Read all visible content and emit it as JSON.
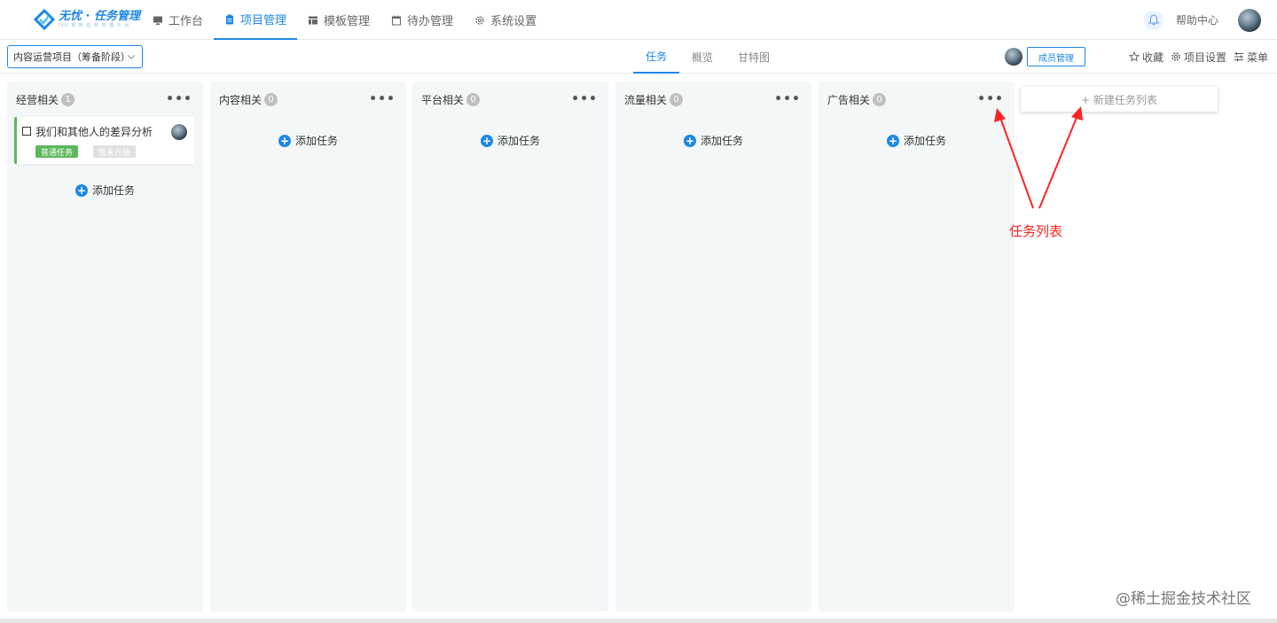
{
  "brand": {
    "title": "无忧 · 任务管理",
    "subtitle": "IVU 项 目 任 务 管 理 平 台"
  },
  "nav": {
    "items": [
      {
        "label": "工作台",
        "icon": "monitor-icon"
      },
      {
        "label": "项目管理",
        "icon": "clipboard-icon",
        "active": true
      },
      {
        "label": "模板管理",
        "icon": "template-icon"
      },
      {
        "label": "待办管理",
        "icon": "calendar-icon"
      },
      {
        "label": "系统设置",
        "icon": "gear-icon"
      }
    ],
    "help": "帮助中心"
  },
  "subbar": {
    "project": "内容运营项目（筹备阶段）",
    "tabs": [
      {
        "label": "任务",
        "active": true
      },
      {
        "label": "概览"
      },
      {
        "label": "甘特图"
      }
    ],
    "member_button": "成员管理",
    "actions": [
      {
        "label": "收藏",
        "icon": "star-icon"
      },
      {
        "label": "项目设置",
        "icon": "gear-icon"
      },
      {
        "label": "菜单",
        "icon": "menu-icon"
      }
    ]
  },
  "columns": [
    {
      "title": "经营相关",
      "count": "1",
      "add_label": "添加任务"
    },
    {
      "title": "内容相关",
      "count": "0",
      "add_label": "添加任务"
    },
    {
      "title": "平台相关",
      "count": "0",
      "add_label": "添加任务"
    },
    {
      "title": "流量相关",
      "count": "0",
      "add_label": "添加任务"
    },
    {
      "title": "广告相关",
      "count": "0",
      "add_label": "添加任务"
    }
  ],
  "task_card": {
    "title": "我们和其他人的差异分析",
    "type_tag": "普通任务",
    "status_tag": "暂未开始",
    "accent_color": "#5cb85c"
  },
  "new_list": {
    "label": "+ 新建任务列表"
  },
  "annotation": {
    "label": "任务列表",
    "color": "#ff2222"
  },
  "watermark": "@稀土掘金技术社区",
  "colors": {
    "primary": "#1e88e5",
    "column_bg": "#f4f7f8"
  }
}
